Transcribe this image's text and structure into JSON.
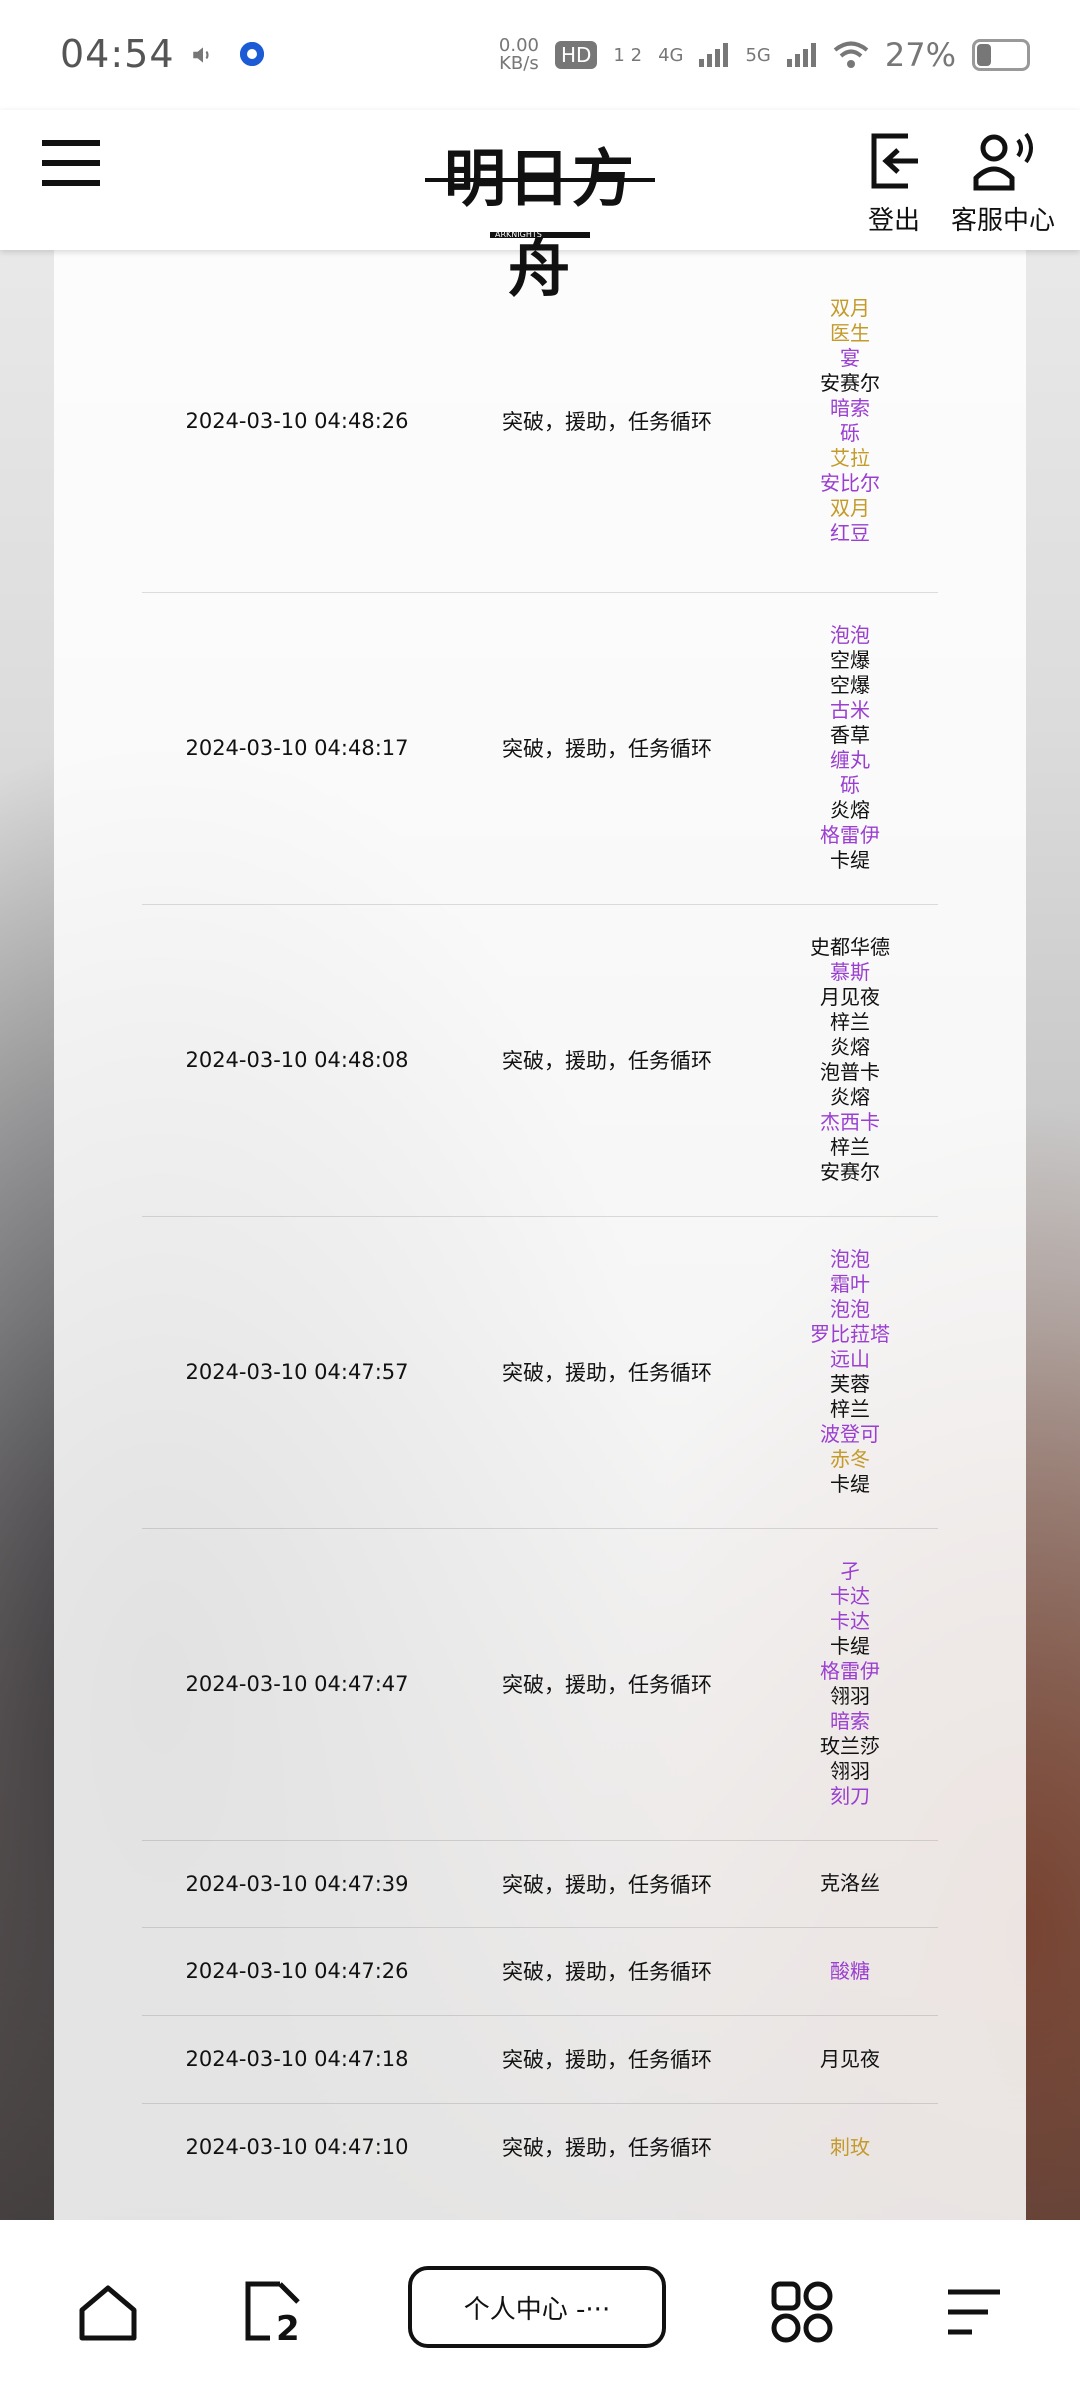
{
  "status_bar": {
    "time": "04:54",
    "net_speed_value": "0.00",
    "net_speed_unit": "KB/s",
    "hd_badge": "HD",
    "hd_sub": "1 2",
    "signal_4g": "4G",
    "signal_5g": "5G",
    "battery_pct": "27%"
  },
  "header": {
    "logo_text": "明日方舟",
    "logo_sub": "ARKNIGHTS",
    "logout_label": "登出",
    "service_label": "客服中心"
  },
  "records": [
    {
      "time": "2024-03-10 04:48:26",
      "type": "突破，援助，任务循环",
      "operators": [
        {
          "name": "双月",
          "color": "gold"
        },
        {
          "name": "医生",
          "color": "gold"
        },
        {
          "name": "宴",
          "color": "purple"
        },
        {
          "name": "安赛尔",
          "color": "black"
        },
        {
          "name": "暗索",
          "color": "purple"
        },
        {
          "name": "砾",
          "color": "purple"
        },
        {
          "name": "艾拉",
          "color": "gold"
        },
        {
          "name": "安比尔",
          "color": "purple"
        },
        {
          "name": "双月",
          "color": "gold"
        },
        {
          "name": "红豆",
          "color": "purple"
        }
      ]
    },
    {
      "time": "2024-03-10 04:48:17",
      "type": "突破，援助，任务循环",
      "operators": [
        {
          "name": "泡泡",
          "color": "purple"
        },
        {
          "name": "空爆",
          "color": "black"
        },
        {
          "name": "空爆",
          "color": "black"
        },
        {
          "name": "古米",
          "color": "purple"
        },
        {
          "name": "香草",
          "color": "black"
        },
        {
          "name": "缠丸",
          "color": "purple"
        },
        {
          "name": "砾",
          "color": "purple"
        },
        {
          "name": "炎熔",
          "color": "black"
        },
        {
          "name": "格雷伊",
          "color": "purple"
        },
        {
          "name": "卡缇",
          "color": "black"
        }
      ]
    },
    {
      "time": "2024-03-10 04:48:08",
      "type": "突破，援助，任务循环",
      "operators": [
        {
          "name": "史都华德",
          "color": "black"
        },
        {
          "name": "慕斯",
          "color": "purple"
        },
        {
          "name": "月见夜",
          "color": "black"
        },
        {
          "name": "梓兰",
          "color": "black"
        },
        {
          "name": "炎熔",
          "color": "black"
        },
        {
          "name": "泡普卡",
          "color": "black"
        },
        {
          "name": "炎熔",
          "color": "black"
        },
        {
          "name": "杰西卡",
          "color": "purple"
        },
        {
          "name": "梓兰",
          "color": "black"
        },
        {
          "name": "安赛尔",
          "color": "black"
        }
      ]
    },
    {
      "time": "2024-03-10 04:47:57",
      "type": "突破，援助，任务循环",
      "operators": [
        {
          "name": "泡泡",
          "color": "purple"
        },
        {
          "name": "霜叶",
          "color": "purple"
        },
        {
          "name": "泡泡",
          "color": "purple"
        },
        {
          "name": "罗比菈塔",
          "color": "purple"
        },
        {
          "name": "远山",
          "color": "purple"
        },
        {
          "name": "芙蓉",
          "color": "black"
        },
        {
          "name": "梓兰",
          "color": "black"
        },
        {
          "name": "波登可",
          "color": "purple"
        },
        {
          "name": "赤冬",
          "color": "gold"
        },
        {
          "name": "卡缇",
          "color": "black"
        }
      ]
    },
    {
      "time": "2024-03-10 04:47:47",
      "type": "突破，援助，任务循环",
      "operators": [
        {
          "name": "孑",
          "color": "purple"
        },
        {
          "name": "卡达",
          "color": "purple"
        },
        {
          "name": "卡达",
          "color": "purple"
        },
        {
          "name": "卡缇",
          "color": "black"
        },
        {
          "name": "格雷伊",
          "color": "purple"
        },
        {
          "name": "翎羽",
          "color": "black"
        },
        {
          "name": "暗索",
          "color": "purple"
        },
        {
          "name": "玫兰莎",
          "color": "black"
        },
        {
          "name": "翎羽",
          "color": "black"
        },
        {
          "name": "刻刀",
          "color": "purple"
        }
      ]
    },
    {
      "time": "2024-03-10 04:47:39",
      "type": "突破，援助，任务循环",
      "operators": [
        {
          "name": "克洛丝",
          "color": "black"
        }
      ]
    },
    {
      "time": "2024-03-10 04:47:26",
      "type": "突破，援助，任务循环",
      "operators": [
        {
          "name": "酸糖",
          "color": "purple"
        }
      ]
    },
    {
      "time": "2024-03-10 04:47:18",
      "type": "突破，援助，任务循环",
      "operators": [
        {
          "name": "月见夜",
          "color": "black"
        }
      ]
    },
    {
      "time": "2024-03-10 04:47:10",
      "type": "突破，援助，任务循环",
      "operators": [
        {
          "name": "刺玫",
          "color": "gold"
        }
      ]
    }
  ],
  "bottom_nav": {
    "pill_label": "个人中心 -···",
    "tab_count": "2"
  },
  "colors": {
    "gold": "#c49a2a",
    "purple": "#9b3fd1",
    "black": "#111111"
  }
}
